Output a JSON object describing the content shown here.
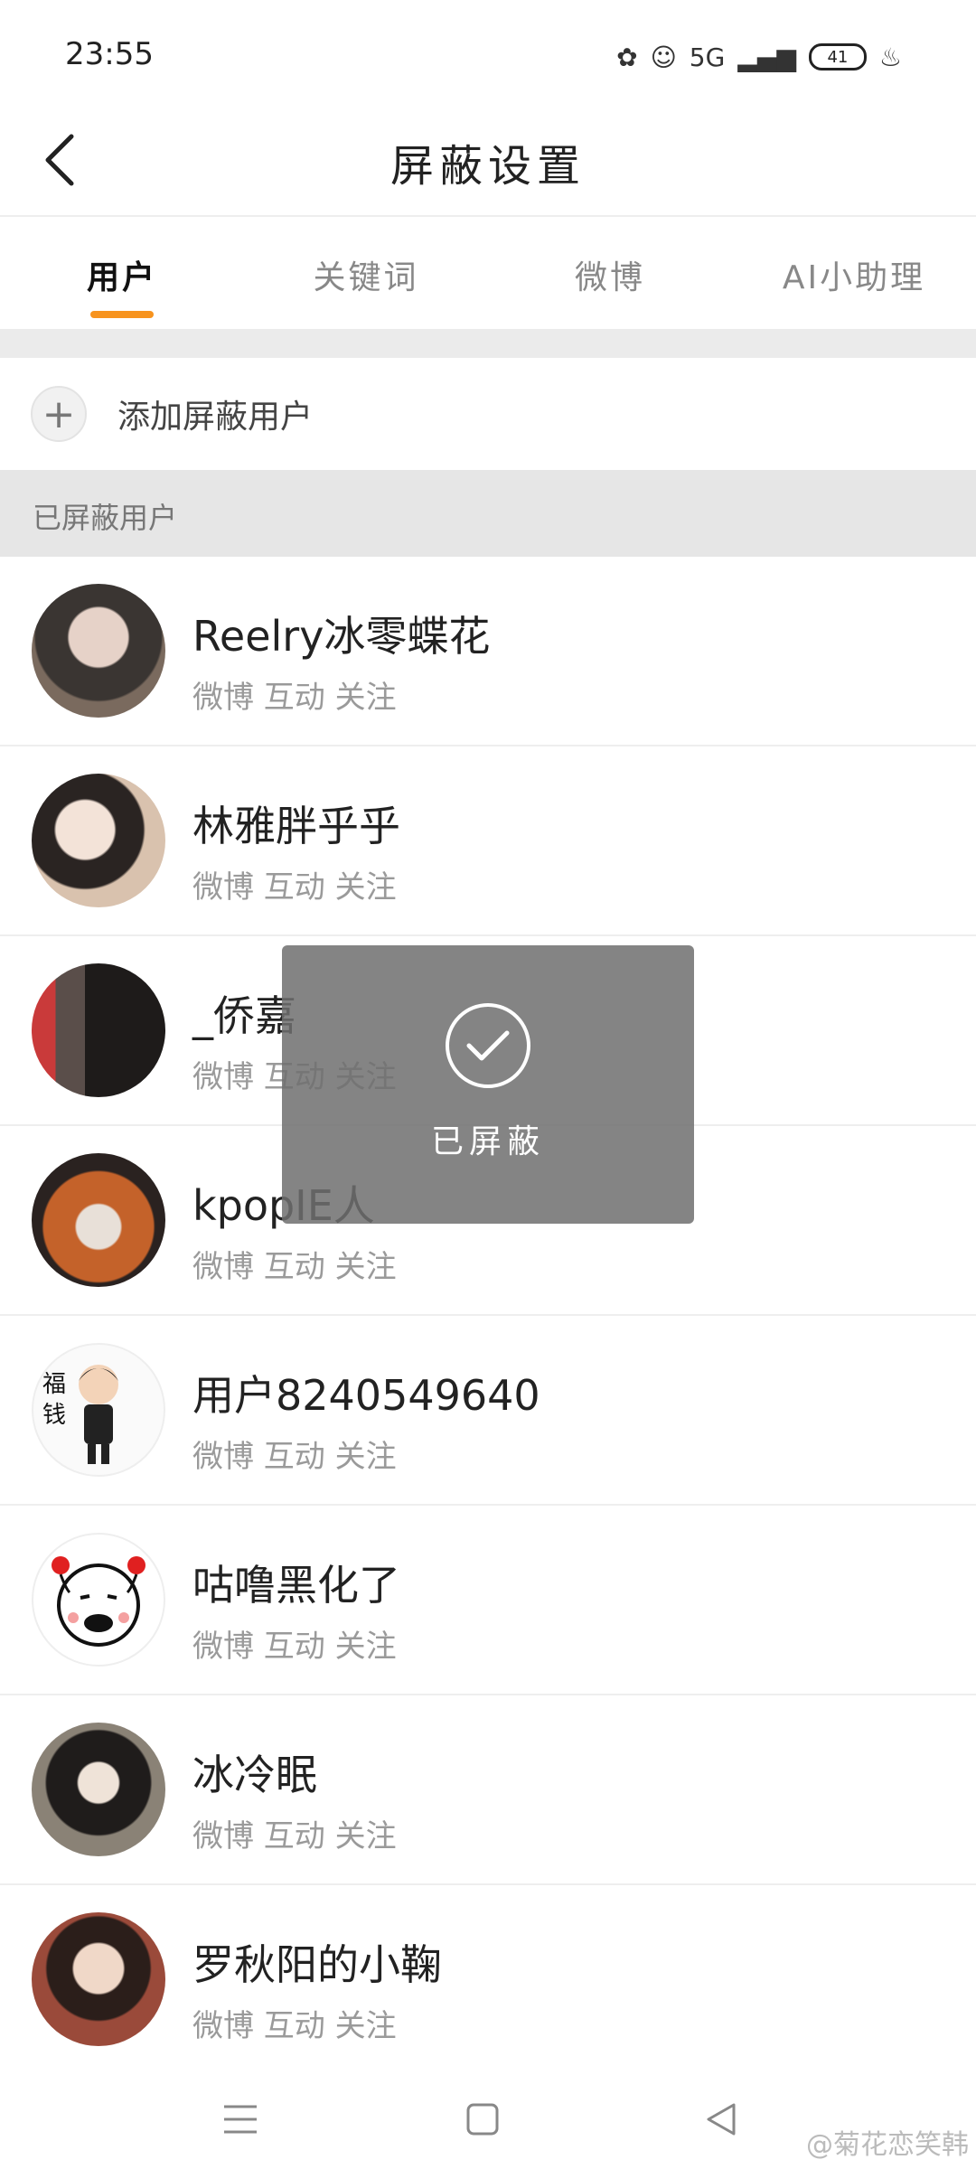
{
  "status_bar": {
    "time": "23:55",
    "network": "5G",
    "battery": "41"
  },
  "header": {
    "title": "屏蔽设置"
  },
  "tabs": [
    {
      "label": "用户",
      "active": true
    },
    {
      "label": "关键词",
      "active": false
    },
    {
      "label": "微博",
      "active": false
    },
    {
      "label": "AI小助理",
      "active": false
    }
  ],
  "add_row": {
    "label": "添加屏蔽用户"
  },
  "section": {
    "title": "已屏蔽用户"
  },
  "users": [
    {
      "name": "Reelry冰零蝶花",
      "sub": "微博 互动 关注"
    },
    {
      "name": "林雅胖乎乎",
      "sub": "微博 互动 关注"
    },
    {
      "name": "_侨嘉",
      "sub": "微博 互动 关注"
    },
    {
      "name": "kpopIE人",
      "sub": "微博 互动 关注"
    },
    {
      "name": "用户8240549640",
      "sub": "微博 互动 关注"
    },
    {
      "name": "咕噜黑化了",
      "sub": "微博 互动 关注"
    },
    {
      "name": "冰冷眠",
      "sub": "微博 互动 关注"
    },
    {
      "name": "罗秋阳的小鞠",
      "sub": "微博 互动 关注"
    }
  ],
  "toast": {
    "text": "已屏蔽"
  },
  "watermark": "@菊花恋笑韩",
  "colors": {
    "accent": "#f7931e",
    "section_bg": "#e6e6e6",
    "sub_text": "#9a9a9a"
  }
}
